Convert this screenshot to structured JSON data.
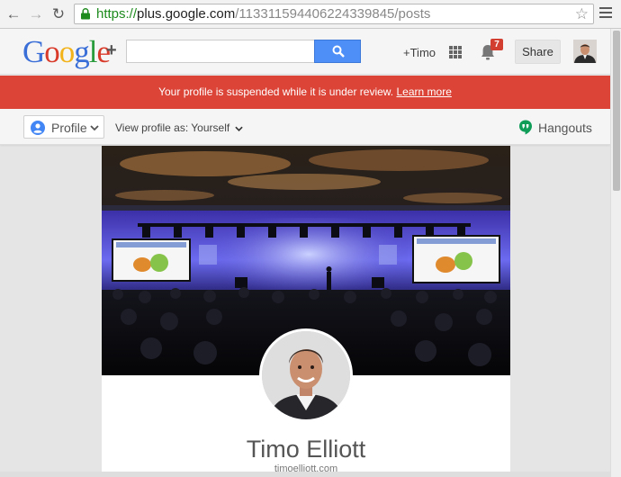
{
  "browser": {
    "url_scheme": "https://",
    "url_host": "plus.google.com",
    "url_path": "/113311594406224339845/posts",
    "back_icon": "arrow-left",
    "forward_icon": "arrow-right",
    "reload_icon": "reload",
    "bookmark_icon": "star-outline",
    "menu_icon": "hamburger"
  },
  "header": {
    "logo_letters": [
      "G",
      "o",
      "o",
      "g",
      "l",
      "e"
    ],
    "logo_plus": "+",
    "search_placeholder": "",
    "user_link": "+Timo",
    "notification_count": "7",
    "share_label": "Share",
    "accent_color": "#4e8ef7"
  },
  "alert": {
    "message": "Your profile is suspended while it is under review.",
    "link": "Learn more",
    "color": "#db4437"
  },
  "toolbar": {
    "profile_label": "Profile",
    "view_as_label": "View profile as:",
    "view_as_value": "Yourself",
    "hangouts_label": "Hangouts",
    "hangouts_color": "#0f9d58"
  },
  "profile": {
    "name": "Timo Elliott",
    "website": "timoelliott.com"
  }
}
